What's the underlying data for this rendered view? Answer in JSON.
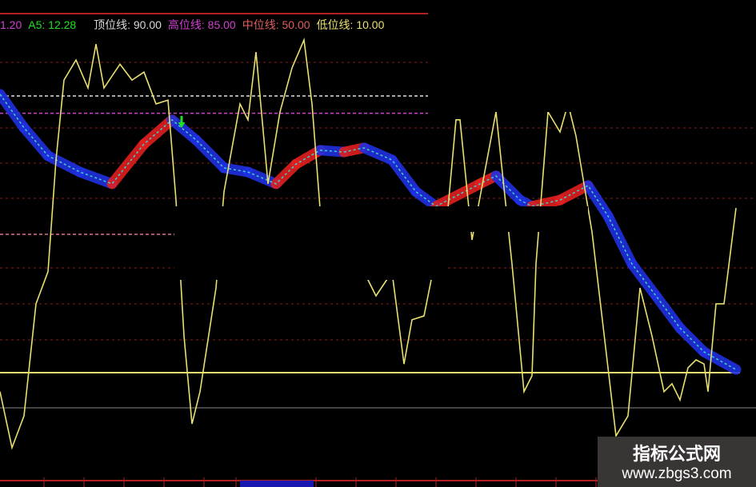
{
  "legend": {
    "a4_fragment": "1.20",
    "a5": "A5: 12.28",
    "top_line": "顶位线: 90.00",
    "high_line": "高位线: 85.00",
    "mid_line": "中位线: 50.00",
    "low_line": "低位线: 10.00"
  },
  "watermark": {
    "title": "指标公式网",
    "url": "www.zbgs3.com"
  },
  "colors": {
    "yellow": "#e8e070",
    "red": "#e02020",
    "blue": "#2030e0",
    "cyan": "#40d0d0",
    "magenta": "#d040d0",
    "white": "#e0e0e0",
    "green": "#20e020"
  },
  "chart_data": {
    "type": "line",
    "title": "",
    "ylim": [
      -23,
      106
    ],
    "reference_lines": [
      {
        "name": "顶位线",
        "value": 90,
        "style": "white-dashed"
      },
      {
        "name": "高位线",
        "value": 85,
        "style": "magenta-dashed"
      },
      {
        "name": "中位线",
        "value": 50,
        "style": "pink-dashed"
      },
      {
        "name": "低位线",
        "value": 10,
        "style": "yellow-solid"
      }
    ],
    "series": [
      {
        "name": "oscillator",
        "color": "yellow",
        "x": [
          0,
          3,
          6,
          9,
          12,
          14,
          16,
          19,
          22,
          24,
          26,
          30,
          33,
          36,
          39,
          42,
          44,
          46,
          48,
          50,
          54,
          56,
          60,
          62,
          64,
          67,
          70,
          73,
          76,
          78,
          80,
          92,
          94,
          98,
          101,
          103,
          106,
          109,
          112,
          114,
          115,
          118,
          124,
          128,
          131,
          133,
          134,
          137,
          140,
          142,
          144,
          148,
          152,
          154,
          157,
          160,
          163,
          166,
          168,
          170,
          172,
          174,
          176,
          177,
          179,
          181,
          184
        ],
        "values": [
          4.5,
          -11.7,
          -2.5,
          29.9,
          39.2,
          71.5,
          94.6,
          100.4,
          92.3,
          105,
          92.3,
          99.2,
          94.6,
          96.9,
          87.7,
          88.8,
          59.9,
          20.6,
          -4.8,
          4.5,
          34.5,
          62.3,
          87.7,
          83.1,
          102.7,
          64.6,
          85.4,
          98.1,
          106.2,
          87.7,
          57.6,
          36.8,
          32.2,
          39.1,
          12.5,
          25.3,
          26.4,
          43.8,
          57.6,
          83.1,
          83.1,
          48.4,
          85.4,
          41.4,
          4.5,
          9.1,
          41.4,
          85.4,
          79.6,
          87.7,
          78.4,
          50.7,
          11.4,
          -8.3,
          -2.5,
          34.5,
          20.6,
          4.5,
          6.8,
          2.1,
          11.4,
          13.7,
          12.5,
          4.5,
          29.9,
          29.9,
          57.6
        ]
      },
      {
        "name": "band",
        "color": "red-rising/blue-falling",
        "x": [
          0,
          6,
          12,
          20,
          28,
          36,
          43,
          49,
          56,
          62,
          69,
          74,
          80,
          86,
          91,
          98,
          104,
          109,
          120,
          124,
          130,
          133,
          140,
          147,
          152,
          158,
          164,
          170,
          176,
          184
        ],
        "values": [
          90.5,
          80.8,
          72.7,
          68,
          64.6,
          76.1,
          83.1,
          77.3,
          69.2,
          68,
          64.6,
          70.3,
          74.3,
          73.8,
          75,
          71.5,
          62.3,
          58.1,
          64.6,
          66.9,
          59.9,
          58.1,
          59.9,
          64.1,
          55.3,
          41.4,
          32.2,
          22.9,
          16,
          10.9
        ]
      }
    ],
    "annotations": [
      {
        "type": "sell-arrow",
        "x": 45
      }
    ]
  }
}
